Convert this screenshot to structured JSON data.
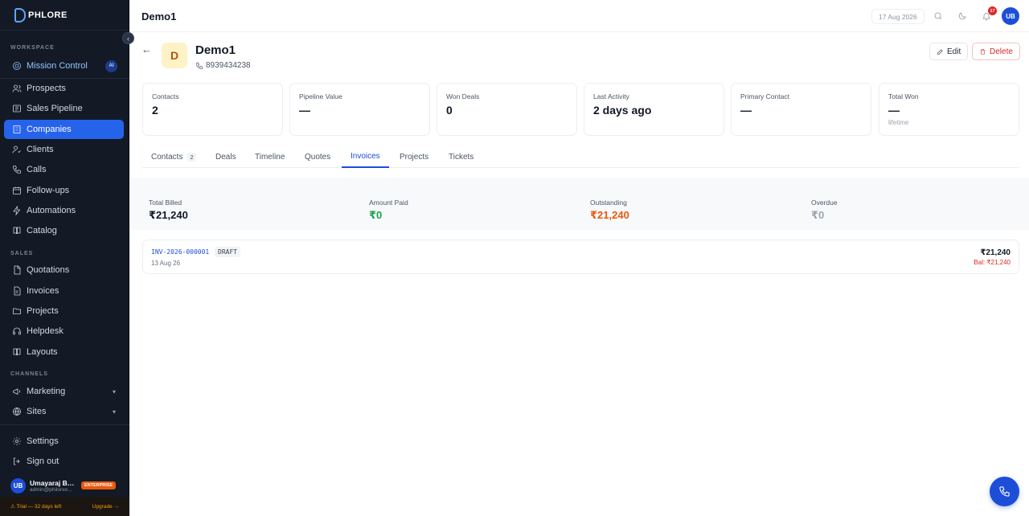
{
  "app": {
    "logo_text": "PHLORE"
  },
  "sidebar": {
    "sections": {
      "workspace": "WORKSPACE",
      "sales": "SALES",
      "channels": "CHANNELS"
    },
    "items": [
      {
        "label": "Mission Control",
        "icon": "target-icon",
        "badge": "AI"
      },
      {
        "label": "Prospects",
        "icon": "users-icon"
      },
      {
        "label": "Sales Pipeline",
        "icon": "pipeline-icon"
      },
      {
        "label": "Companies",
        "icon": "building-icon",
        "active": true
      },
      {
        "label": "Clients",
        "icon": "user-check-icon"
      },
      {
        "label": "Calls",
        "icon": "phone-icon"
      },
      {
        "label": "Follow-ups",
        "icon": "calendar-icon"
      },
      {
        "label": "Automations",
        "icon": "zap-icon"
      },
      {
        "label": "Catalog",
        "icon": "book-icon"
      },
      {
        "label": "Quotations",
        "icon": "file-icon"
      },
      {
        "label": "Invoices",
        "icon": "file-text-icon"
      },
      {
        "label": "Projects",
        "icon": "folder-icon"
      },
      {
        "label": "Helpdesk",
        "icon": "headset-icon"
      },
      {
        "label": "Layouts",
        "icon": "layout-icon"
      },
      {
        "label": "Marketing",
        "icon": "megaphone-icon"
      },
      {
        "label": "Sites",
        "icon": "globe-icon"
      },
      {
        "label": "Settings",
        "icon": "gear-icon"
      },
      {
        "label": "Sign out",
        "icon": "logout-icon"
      }
    ],
    "user": {
      "initials": "UB",
      "name": "Umayaraj Bal...",
      "email": "admin@philorex...",
      "plan_badge": "ENTERPRISE"
    },
    "trial": {
      "text": "⚠ Trial — 32 days left",
      "upgrade": "Upgrade →"
    }
  },
  "header": {
    "title": "Demo1",
    "date": "17 Aug 2026",
    "notification_count": "17",
    "avatar_initials": "UB"
  },
  "company": {
    "initial": "D",
    "name": "Demo1",
    "phone": "8939434238",
    "edit_label": "Edit",
    "delete_label": "Delete"
  },
  "stats": [
    {
      "label": "Contacts",
      "value": "2",
      "sub": ""
    },
    {
      "label": "Pipeline Value",
      "value": "—",
      "sub": ""
    },
    {
      "label": "Won Deals",
      "value": "0",
      "sub": ""
    },
    {
      "label": "Last Activity",
      "value": "2 days ago",
      "sub": ""
    },
    {
      "label": "Primary Contact",
      "value": "—",
      "sub": ""
    },
    {
      "label": "Total Won",
      "value": "—",
      "sub": "lifetime"
    }
  ],
  "tabs": [
    {
      "label": "Contacts",
      "count": "2"
    },
    {
      "label": "Deals"
    },
    {
      "label": "Timeline"
    },
    {
      "label": "Quotes"
    },
    {
      "label": "Invoices",
      "active": true
    },
    {
      "label": "Projects"
    },
    {
      "label": "Tickets"
    }
  ],
  "invoice_summary": [
    {
      "label": "Total Billed",
      "value": "₹21,240",
      "color": "#111827"
    },
    {
      "label": "Amount Paid",
      "value": "₹0",
      "color": "#16a34a"
    },
    {
      "label": "Outstanding",
      "value": "₹21,240",
      "color": "#ea580c"
    },
    {
      "label": "Overdue",
      "value": "₹0",
      "color": "#9ca3af"
    }
  ],
  "invoices": [
    {
      "number": "INV-2026-000001",
      "status": "DRAFT",
      "date": "13 Aug 26",
      "amount": "₹21,240",
      "balance": "Bal: ₹21,240"
    }
  ],
  "colors": {
    "accent": "#1d4ed8",
    "sidebar_bg": "#131a26",
    "danger": "#dc2626",
    "success": "#16a34a",
    "warning": "#ea580c"
  }
}
